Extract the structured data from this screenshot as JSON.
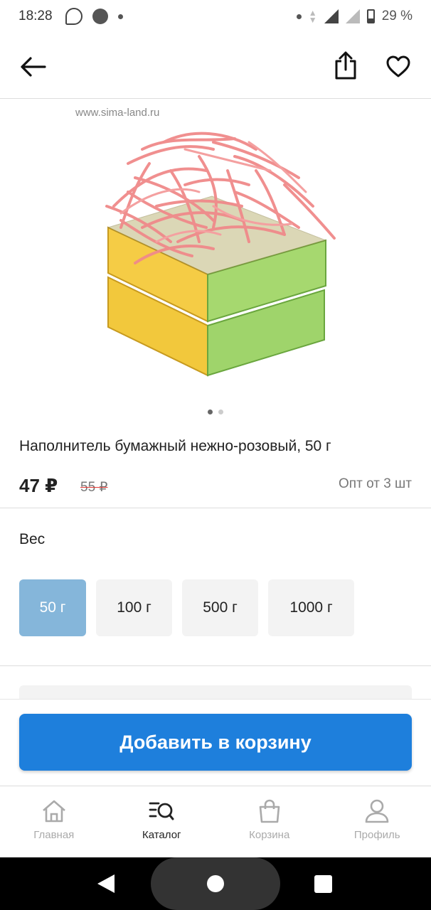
{
  "status_bar": {
    "time": "18:28",
    "battery": "29 %"
  },
  "product": {
    "watermark": "www.sima-land.ru",
    "title": "Наполнитель бумажный нежно-розовый, 50 г",
    "price": "47 ₽",
    "old_price": "55 ₽",
    "wholesale": "Опт от 3 шт",
    "image_count": 2,
    "image_active": 1
  },
  "weight": {
    "label": "Вес",
    "options": [
      "50 г",
      "100 г",
      "500 г",
      "1000 г"
    ],
    "selected": "50 г"
  },
  "cart_button": "Добавить в корзину",
  "bottom_nav": {
    "home": "Главная",
    "catalog": "Каталог",
    "cart": "Корзина",
    "profile": "Профиль",
    "active": "Каталог"
  },
  "colors": {
    "accent": "#1e7fdc",
    "selected_option": "#85b6da",
    "strike": "#e53935"
  }
}
